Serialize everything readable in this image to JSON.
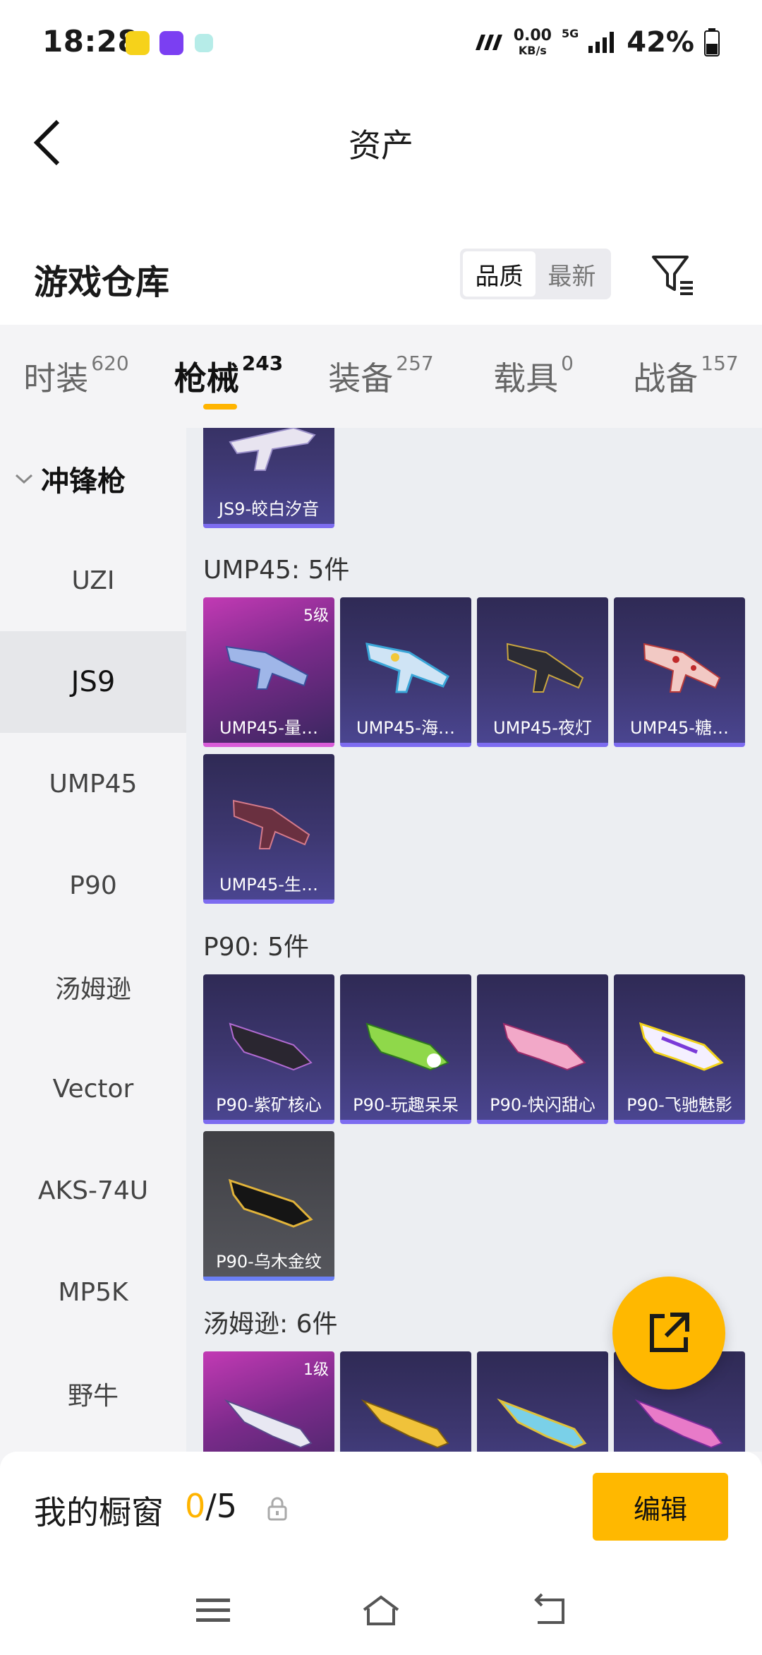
{
  "status_bar": {
    "time": "18:28",
    "net_speed_value": "0.00",
    "net_speed_unit": "KB/s",
    "signal_type": "5G",
    "battery": "42%"
  },
  "header": {
    "title": "资产"
  },
  "warehouse": {
    "title": "游戏仓库",
    "sort_options": [
      "品质",
      "最新"
    ],
    "active_sort": "品质"
  },
  "tabs": [
    {
      "label": "时装",
      "count": "620"
    },
    {
      "label": "枪械",
      "count": "243",
      "active": true
    },
    {
      "label": "装备",
      "count": "257"
    },
    {
      "label": "载具",
      "count": "0"
    },
    {
      "label": "战备",
      "count": "157"
    }
  ],
  "sidebar": {
    "group_label": "冲锋枪",
    "items": [
      "UZI",
      "JS9",
      "UMP45",
      "P90",
      "汤姆逊",
      "Vector",
      "AKS-74U",
      "MP5K",
      "野牛"
    ],
    "active_item": "JS9"
  },
  "groups": [
    {
      "label": "",
      "items": [
        {
          "name": "JS9-皎白汐音"
        }
      ]
    },
    {
      "label": "UMP45: 5件",
      "items": [
        {
          "name": "UMP45-量…",
          "tier": "5级"
        },
        {
          "name": "UMP45-海…"
        },
        {
          "name": "UMP45-夜灯"
        },
        {
          "name": "UMP45-糖…"
        },
        {
          "name": "UMP45-生…"
        }
      ]
    },
    {
      "label": "P90: 5件",
      "items": [
        {
          "name": "P90-紫矿核心"
        },
        {
          "name": "P90-玩趣呆呆"
        },
        {
          "name": "P90-快闪甜心"
        },
        {
          "name": "P90-飞驰魅影"
        },
        {
          "name": "P90-乌木金纹"
        }
      ]
    },
    {
      "label": "汤姆逊: 6件",
      "items": [
        {
          "name": "",
          "tier": "1级"
        },
        {
          "name": ""
        },
        {
          "name": ""
        },
        {
          "name": ""
        }
      ]
    }
  ],
  "showcase": {
    "title": "我的橱窗",
    "used": "0",
    "sep": "/",
    "total": "5",
    "edit_label": "编辑"
  },
  "colors": {
    "accent": "#ffb800",
    "card_purple": "#c23ab4",
    "card_blue": "#3d3770"
  }
}
